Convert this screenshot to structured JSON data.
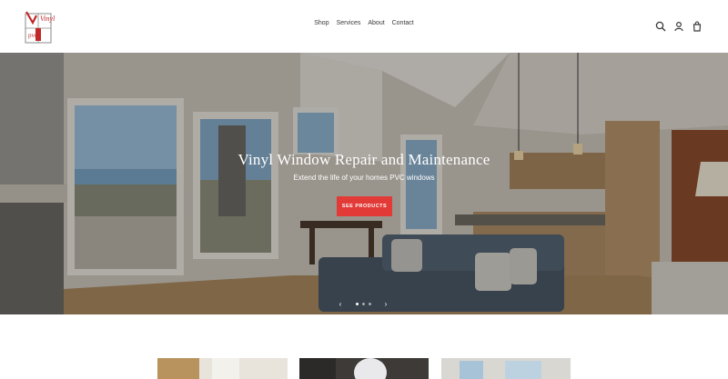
{
  "brand": {
    "logo_text": "Vinyl",
    "logo_sub": "pvc"
  },
  "nav": {
    "items": [
      "Shop",
      "Services",
      "About",
      "Contact"
    ]
  },
  "header_icons": [
    "search-icon",
    "account-icon",
    "cart-icon"
  ],
  "hero": {
    "title": "Vinyl Window Repair and Maintenance",
    "subtitle": "Extend the life of your homes PVC windows",
    "button_label": "SEE PRODUCTS",
    "slide_count": 3,
    "active_slide": 1
  },
  "colors": {
    "accent": "#e23a36",
    "logo_red": "#c0282a",
    "text": "#3a3a3a"
  },
  "products": [
    "product-card-1",
    "product-card-2",
    "product-card-3"
  ]
}
